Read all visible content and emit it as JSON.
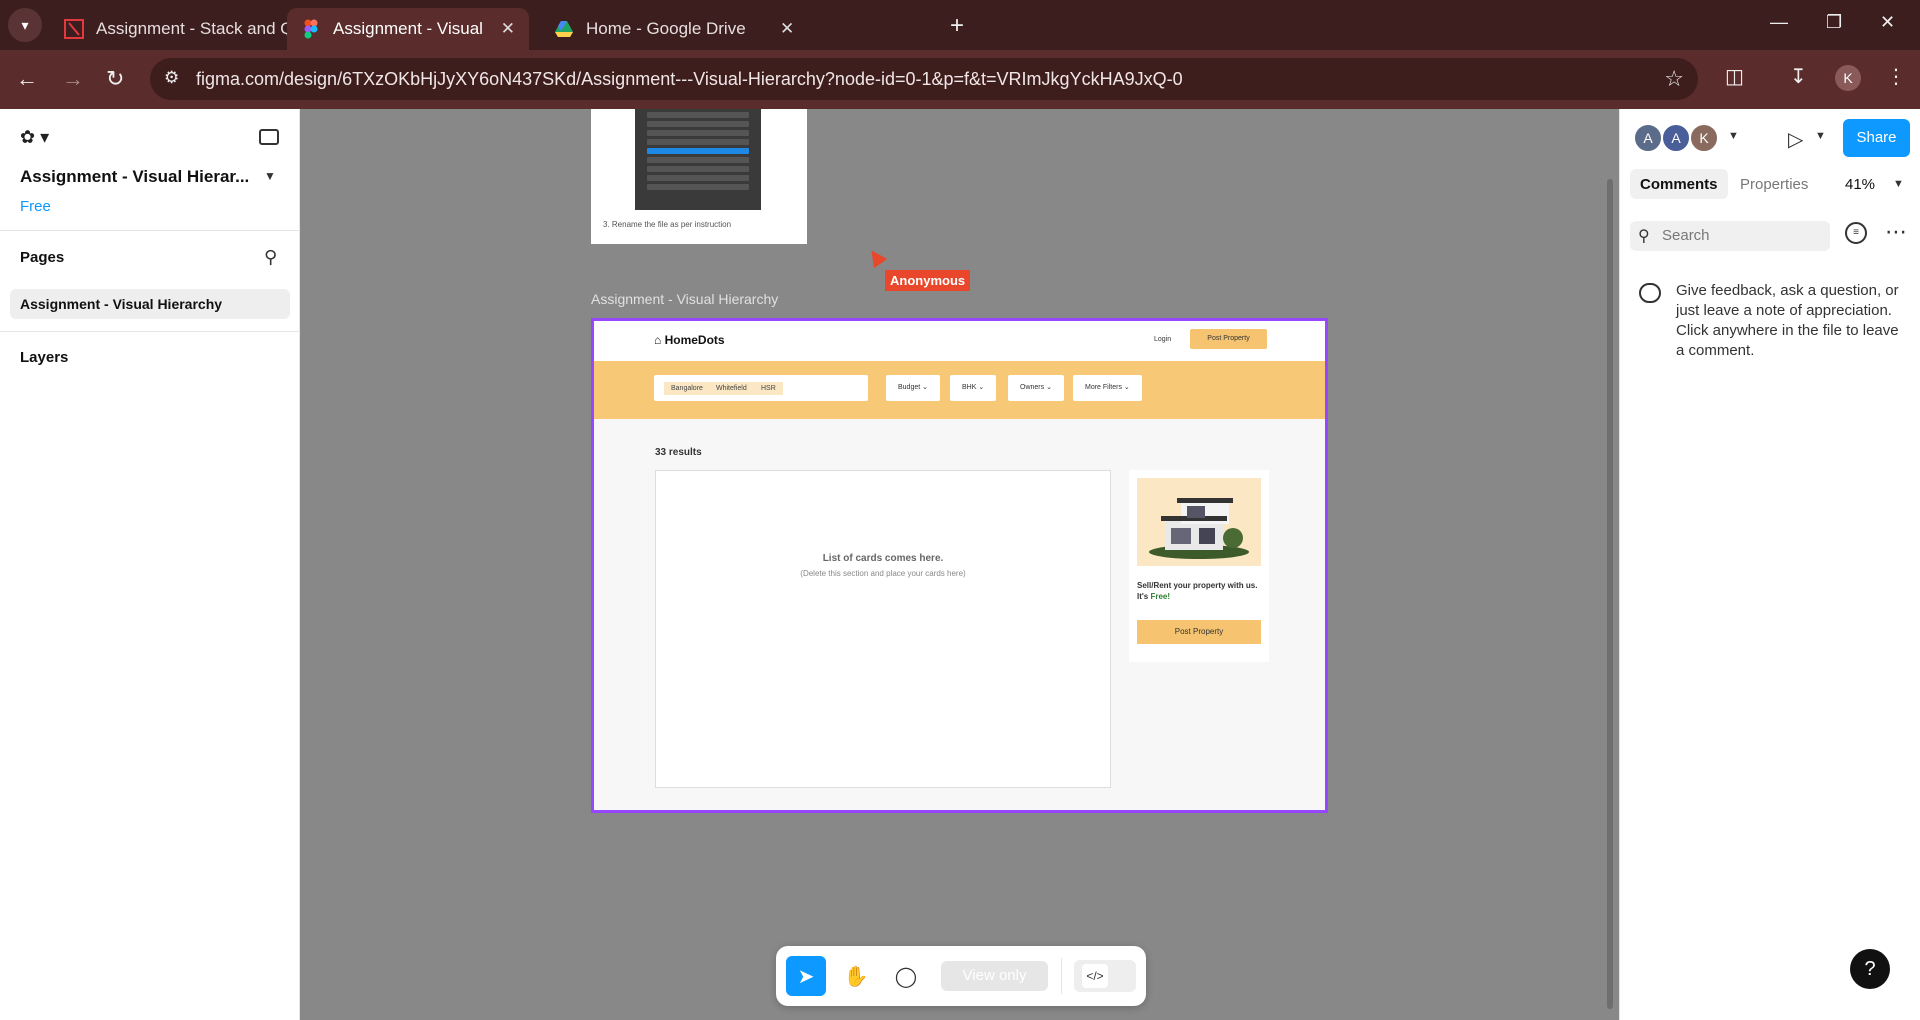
{
  "browser": {
    "tabs": [
      {
        "title": "Assignment - Stack and Queue",
        "active": false,
        "favicon": "stack-queue-favicon"
      },
      {
        "title": "Assignment - Visual Hierarchy -",
        "active": true,
        "favicon": "figma-favicon"
      },
      {
        "title": "Home - Google Drive",
        "active": false,
        "favicon": "drive-favicon"
      }
    ],
    "url": "figma.com/design/6TXzOKbHjJyXY6oN437SKd/Assignment---Visual-Hierarchy?node-id=0-1&p=f&t=VRImJkgYckHA9JxQ-0",
    "profile_initial": "K"
  },
  "left_panel": {
    "file_title": "Assignment - Visual Hierar...",
    "plan": "Free",
    "pages_heading": "Pages",
    "pages": [
      "Assignment - Visual Hierarchy"
    ],
    "layers_heading": "Layers"
  },
  "canvas": {
    "thumbnail_caption": "3. Rename the file as per instruction",
    "cursor_label": "Anonymous",
    "frame_label": "Assignment - Visual Hierarchy",
    "design": {
      "logo": "HomeDots",
      "login": "Login",
      "post_property": "Post Property",
      "location_chips": [
        "Bangalore",
        "Whitefield",
        "HSR"
      ],
      "filters": [
        "Budget",
        "BHK",
        "Owners",
        "More Filters"
      ],
      "results": "33 results",
      "cards_placeholder_title": "List of cards comes here.",
      "cards_placeholder_sub": "(Delete this section and place your cards here)",
      "promo_text": "Sell/Rent your property with us. It's",
      "promo_free": "Free!",
      "promo_button": "Post Property"
    }
  },
  "toolbar": {
    "view_only": "View only",
    "dev_label": "</>"
  },
  "right_panel": {
    "avatars": [
      {
        "initial": "A",
        "color": "#5b6b8a"
      },
      {
        "initial": "A",
        "color": "#4a5f99"
      },
      {
        "initial": "K",
        "color": "#8a6a5e"
      }
    ],
    "share": "Share",
    "tabs": [
      "Comments",
      "Properties"
    ],
    "zoom": "41%",
    "search_placeholder": "Search",
    "comment_help": "Give feedback, ask a question, or just leave a note of appreciation. Click anywhere in the file to leave a comment.",
    "help": "?"
  },
  "colors": {
    "figma_blue": "#0d99ff",
    "frame_selection": "#9747ff",
    "homedots_accent": "#f7c875",
    "browser_chrome": "#5b2c2c"
  }
}
